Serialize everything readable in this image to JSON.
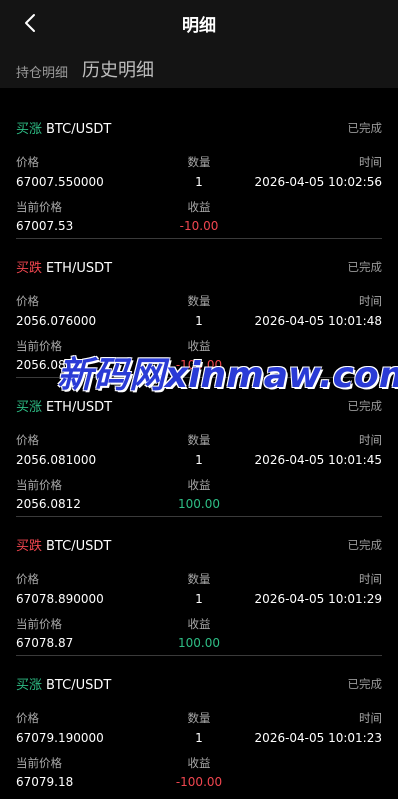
{
  "header": {
    "title": "明细",
    "back_icon": "chevron-left-icon"
  },
  "tabs": {
    "holdings": "持仓明细",
    "history": "历史明细"
  },
  "labels": {
    "price": "价格",
    "quantity": "数量",
    "time": "时间",
    "current_price": "当前价格",
    "profit": "收益"
  },
  "colors": {
    "up": "#2ebd85",
    "down": "#f0464f",
    "background": "#000000",
    "header_bg": "#141414"
  },
  "orders": [
    {
      "direction": "买涨",
      "direction_type": "up",
      "symbol": "BTC/USDT",
      "status": "已完成",
      "price": "67007.550000",
      "quantity": "1",
      "time": "2026-04-05 10:02:56",
      "current_price": "67007.53",
      "profit": "-10.00"
    },
    {
      "direction": "买跌",
      "direction_type": "down",
      "symbol": "ETH/USDT",
      "status": "已完成",
      "price": "2056.076000",
      "quantity": "1",
      "time": "2026-04-05 10:01:48",
      "current_price": "2056.0812",
      "profit": "-100.00"
    },
    {
      "direction": "买涨",
      "direction_type": "up",
      "symbol": "ETH/USDT",
      "status": "已完成",
      "price": "2056.081000",
      "quantity": "1",
      "time": "2026-04-05 10:01:45",
      "current_price": "2056.0812",
      "profit": "100.00"
    },
    {
      "direction": "买跌",
      "direction_type": "down",
      "symbol": "BTC/USDT",
      "status": "已完成",
      "price": "67078.890000",
      "quantity": "1",
      "time": "2026-04-05 10:01:29",
      "current_price": "67078.87",
      "profit": "100.00"
    },
    {
      "direction": "买涨",
      "direction_type": "up",
      "symbol": "BTC/USDT",
      "status": "已完成",
      "price": "67079.190000",
      "quantity": "1",
      "time": "2026-04-05 10:01:23",
      "current_price": "67079.18",
      "profit": "-100.00"
    }
  ],
  "watermark": "新码网xinmaw.com"
}
